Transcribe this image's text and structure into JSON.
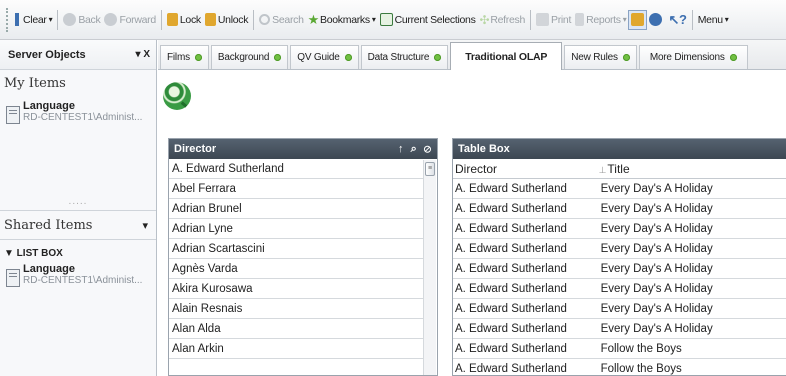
{
  "toolbar": {
    "clear": "Clear",
    "back": "Back",
    "forward": "Forward",
    "lock": "Lock",
    "unlock": "Unlock",
    "search": "Search",
    "bookmarks": "Bookmarks",
    "current_selections": "Current Selections",
    "refresh": "Refresh",
    "print": "Print",
    "reports": "Reports",
    "menu": "Menu",
    "caret": "▾"
  },
  "left_panel": {
    "title": "Server Objects",
    "controls": "▾ X",
    "my_items_label": "My Items",
    "my_item": {
      "name": "Language",
      "path": "RD-CENTEST1\\Administ..."
    },
    "dots": ".....",
    "shared_items_label": "Shared Items",
    "shared_caret": "▾",
    "list_box_label": "▼ LIST BOX",
    "shared_item": {
      "name": "Language",
      "path": "RD-CENTEST1\\Administ..."
    }
  },
  "tabs": [
    {
      "label": "Films",
      "dot": true
    },
    {
      "label": "Background",
      "dot": true
    },
    {
      "label": "QV Guide",
      "dot": true
    },
    {
      "label": "Data Structure",
      "dot": true
    },
    {
      "label": "Traditional OLAP",
      "dot": false,
      "active": true
    },
    {
      "label": "New Rules",
      "dot": true
    },
    {
      "label": "More Dimensions",
      "dot": true
    }
  ],
  "listbox": {
    "title": "Director",
    "icons": "↑ ⌕ ⊘",
    "items": [
      "A. Edward Sutherland",
      "Abel Ferrara",
      "Adrian Brunel",
      "Adrian Lyne",
      "Adrian Scartascini",
      "Agnès Varda",
      "Akira Kurosawa",
      "Alain Resnais",
      "Alan Alda",
      "Alan Arkin"
    ]
  },
  "tablebox": {
    "title": "Table Box",
    "columns": [
      "Director",
      "Title"
    ],
    "rows": [
      [
        "A. Edward Sutherland",
        "Every Day's A Holiday"
      ],
      [
        "A. Edward Sutherland",
        "Every Day's A Holiday"
      ],
      [
        "A. Edward Sutherland",
        "Every Day's A Holiday"
      ],
      [
        "A. Edward Sutherland",
        "Every Day's A Holiday"
      ],
      [
        "A. Edward Sutherland",
        "Every Day's A Holiday"
      ],
      [
        "A. Edward Sutherland",
        "Every Day's A Holiday"
      ],
      [
        "A. Edward Sutherland",
        "Every Day's A Holiday"
      ],
      [
        "A. Edward Sutherland",
        "Every Day's A Holiday"
      ],
      [
        "A. Edward Sutherland",
        "Follow the Boys"
      ],
      [
        "A. Edward Sutherland",
        "Follow the Boys"
      ]
    ]
  },
  "colors": {
    "tab_dot": "#71c043",
    "caption_bg": "#4a5561",
    "logo": "#2e8b3a"
  }
}
